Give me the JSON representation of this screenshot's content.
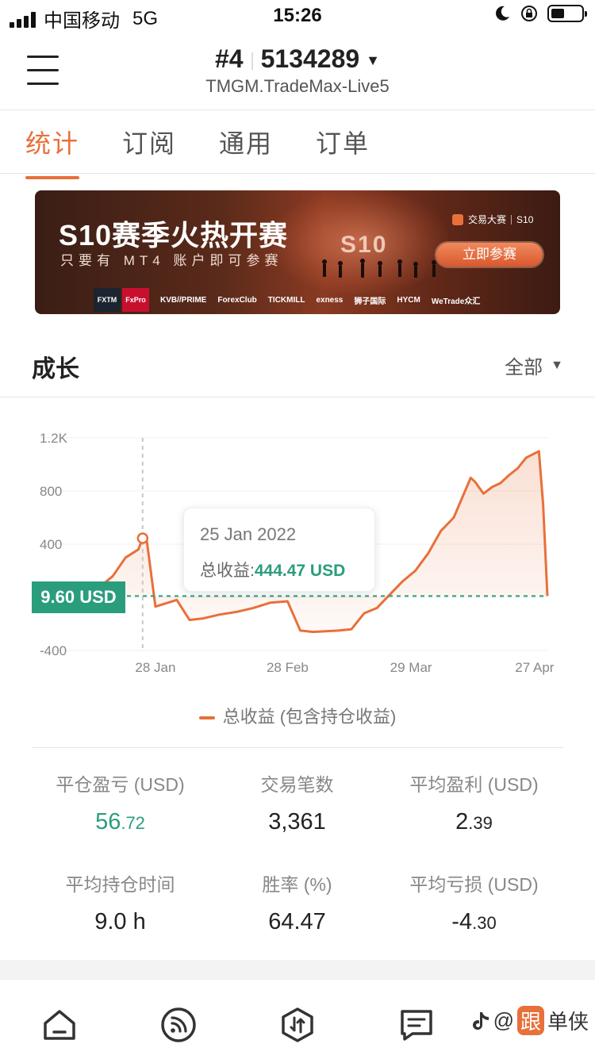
{
  "status_bar": {
    "carrier": "中国移动",
    "network": "5G",
    "time": "15:26"
  },
  "header": {
    "account_index": "#4",
    "account_number": "5134289",
    "server": "TMGM.TradeMax-Live5"
  },
  "tabs": [
    {
      "label": "统计",
      "active": true
    },
    {
      "label": "订阅",
      "active": false
    },
    {
      "label": "通用",
      "active": false
    },
    {
      "label": "订单",
      "active": false
    }
  ],
  "banner": {
    "title": "S10赛季火热开赛",
    "subtitle": "只要有 MT4 账户即可参赛",
    "season_mark": "S10",
    "brand": "交易大赛",
    "brand_season": "S10",
    "cta": "立即参赛",
    "partners": [
      "FXTM",
      "FxPro",
      "KVB//PRIME",
      "ForexClub",
      "TICKMILL",
      "exness",
      "狮子国际",
      "HYCM",
      "WeTrade众汇"
    ]
  },
  "growth": {
    "title": "成长",
    "filter": "全部"
  },
  "chart_data": {
    "type": "area",
    "series": [
      {
        "name": "总收益 (包含持仓收益)",
        "color": "#e8703a",
        "x": [
          "2022-01-12",
          "2022-01-15",
          "2022-01-18",
          "2022-01-21",
          "2022-01-24",
          "2022-01-25",
          "2022-01-26",
          "2022-01-28",
          "2022-01-31",
          "2022-02-02",
          "2022-02-05",
          "2022-02-08",
          "2022-02-12",
          "2022-02-16",
          "2022-02-20",
          "2022-02-24",
          "2022-02-28",
          "2022-03-03",
          "2022-03-06",
          "2022-03-09",
          "2022-03-12",
          "2022-03-15",
          "2022-03-18",
          "2022-03-21",
          "2022-03-24",
          "2022-03-27",
          "2022-03-30",
          "2022-04-02",
          "2022-04-05",
          "2022-04-08",
          "2022-04-10",
          "2022-04-12",
          "2022-04-13",
          "2022-04-15",
          "2022-04-17",
          "2022-04-19",
          "2022-04-21",
          "2022-04-23",
          "2022-04-25",
          "2022-04-28",
          "2022-04-29",
          "2022-04-30"
        ],
        "values": [
          50,
          80,
          160,
          300,
          360,
          444.47,
          420,
          -70,
          -40,
          -20,
          -170,
          -160,
          -130,
          -110,
          -80,
          -40,
          -30,
          -250,
          -260,
          -255,
          -250,
          -240,
          -120,
          -80,
          20,
          120,
          200,
          330,
          500,
          600,
          750,
          900,
          870,
          780,
          830,
          860,
          920,
          970,
          1050,
          1100,
          700,
          9.6
        ]
      }
    ],
    "baseline": {
      "value": 9.6,
      "label": "9.60 USD"
    },
    "y_ticks": [
      "1.2K",
      "800",
      "400",
      "-400"
    ],
    "x_ticks": [
      "28 Jan",
      "28 Feb",
      "29 Mar",
      "27 Apr"
    ],
    "ylim": [
      -400,
      1200
    ],
    "tooltip": {
      "date": "25 Jan 2022",
      "label": "总收益:",
      "value": "444.47 USD"
    },
    "legend": "总收益 (包含持仓收益)"
  },
  "stats": [
    {
      "label": "平仓盈亏 (USD)",
      "int": "56",
      "dec": ".72",
      "color": "green"
    },
    {
      "label": "交易笔数",
      "int": "3,361",
      "dec": ""
    },
    {
      "label": "平均盈利 (USD)",
      "int": "2",
      "dec": ".39"
    },
    {
      "label": "平均持仓时间",
      "int": "9.0 h",
      "dec": ""
    },
    {
      "label": "胜率 (%)",
      "int": "64.47",
      "dec": ""
    },
    {
      "label": "平均亏损 (USD)",
      "int": "-4",
      "dec": ".30"
    }
  ],
  "watermark": {
    "prefix": "@",
    "badge": "跟",
    "text": "单侠"
  }
}
